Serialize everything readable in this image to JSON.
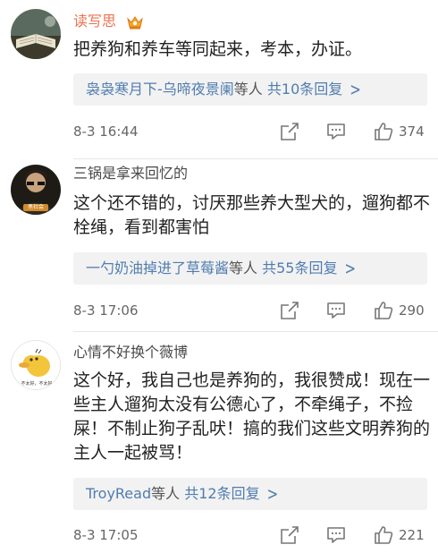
{
  "comments": [
    {
      "username": "读写思",
      "vip": true,
      "text": "把养狗和养车等同起来，考本，办证。",
      "reply_names": "袅袅寒月下-乌啼夜景阑",
      "reply_suffix": "等人",
      "reply_count": "共10条回复",
      "time": "8-3 16:44",
      "likes": "374"
    },
    {
      "username": "三锅是拿来回忆的",
      "vip": false,
      "text": "这个还不错的，讨厌那些养大型犬的，遛狗都不栓绳，看到都害怕",
      "reply_names": "一勺奶油掉进了草莓酱",
      "reply_suffix": "等人",
      "reply_count": "共55条回复",
      "time": "8-3 17:06",
      "likes": "290",
      "avatar_caption": "黑社会"
    },
    {
      "username": "心情不好换个薇博",
      "vip": false,
      "text": "这个好，我自己也是养狗的，我很赞成！现在一些主人遛狗太没有公德心了，不牵绳子，不捡屎！不制止狗子乱吠！搞的我们这些文明养狗的主人一起被骂！",
      "reply_names": "TroyRead",
      "reply_suffix": "等人",
      "reply_count": "共12条回复",
      "time": "8-3 17:05",
      "likes": "221",
      "avatar_caption": "不太好，不太好"
    }
  ],
  "icons": {
    "vip": "vip-crown-icon",
    "share": "share-icon",
    "comment": "comment-icon",
    "like": "thumbs-up-icon"
  }
}
